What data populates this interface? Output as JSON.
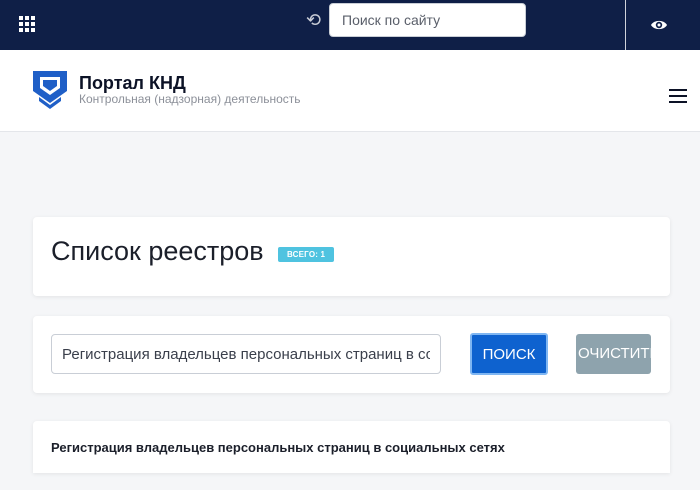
{
  "topbar": {
    "apps_icon": "grid-icon",
    "reload_icon": "reload-icon",
    "search": {
      "placeholder": "Поиск по сайту",
      "value": ""
    },
    "accessibility_icon": "eye-icon"
  },
  "header": {
    "logo_icon": "shield-logo",
    "title": "Портал КНД",
    "subtitle": "Контрольная (надзорная) деятельность",
    "menu_icon": "hamburger-icon"
  },
  "main": {
    "page_title": "Список реестров",
    "count_badge": "ВСЕГО: 1",
    "query": "Регистрация владельцев персональных страниц в социальных сетях",
    "search_button": "ПОИСК",
    "clear_button": "ОЧИСТИТЬ",
    "results": [
      {
        "title": "Регистрация владельцев персональных страниц в социальных сетях"
      }
    ]
  },
  "colors": {
    "topbar": "#0f1f47",
    "primary_button": "#0e62cf",
    "clear_button": "#8ea3ad",
    "badge": "#4fc3e0"
  }
}
